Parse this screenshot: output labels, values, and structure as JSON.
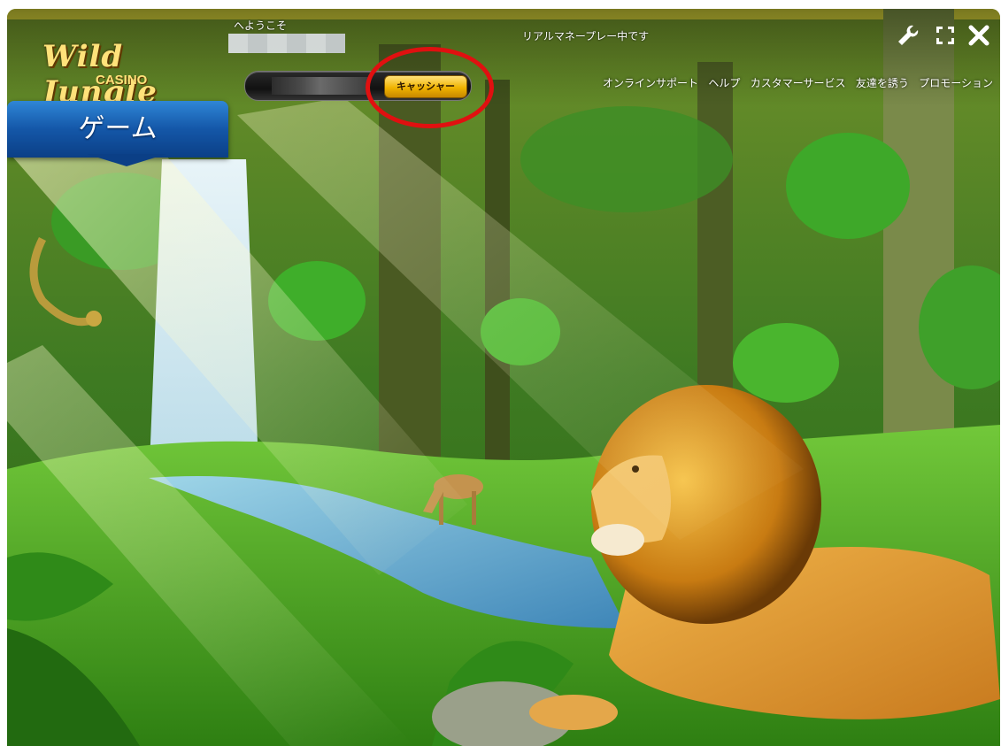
{
  "header": {
    "logo_title": "Wild Jungle",
    "logo_subtitle": "CASINO",
    "welcome_label": "へようこそ",
    "mode_text": "リアルマネープレー中です"
  },
  "account": {
    "cashier_label": "キャッシャー"
  },
  "nav": {
    "items": [
      "オンラインサポート",
      "ヘルプ",
      "カスタマーサービス",
      "友達を誘う",
      "プロモーション"
    ]
  },
  "sidebar": {
    "games_tab_label": "ゲーム"
  },
  "toolbar": {
    "icons": [
      "wrench-icon",
      "fullscreen-icon",
      "close-icon"
    ]
  },
  "annotation": {
    "highlight_color": "#e01010"
  }
}
